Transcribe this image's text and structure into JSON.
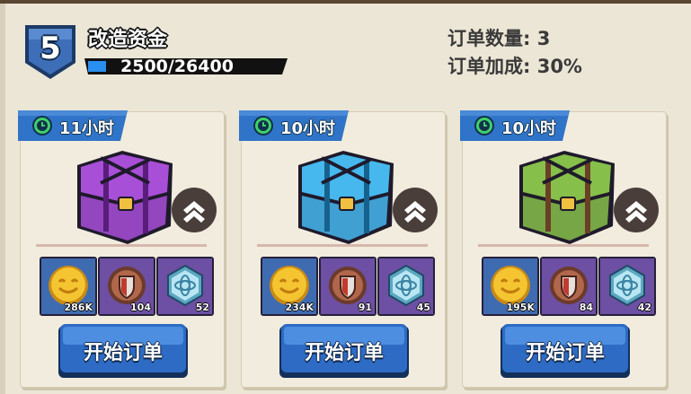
{
  "header": {
    "level": "5",
    "title": "改造资金",
    "progress_text": "2500/26400",
    "progress_value": 2500,
    "progress_max": 26400,
    "order_count": "订单数量: 3",
    "order_bonus": "订单加成: 30%"
  },
  "cards": [
    {
      "timer": "11小时",
      "chest_color": "#a84fd8",
      "chest_trim": "#5a1d7c",
      "rewards": [
        {
          "icon": "gold-coin-icon",
          "count": "286K"
        },
        {
          "icon": "bronze-shield-medal-icon",
          "count": "104"
        },
        {
          "icon": "blue-hexagon-gem-icon",
          "count": "52"
        }
      ],
      "button": "开始订单"
    },
    {
      "timer": "10小时",
      "chest_color": "#46b8ee",
      "chest_trim": "#16628f",
      "rewards": [
        {
          "icon": "gold-coin-icon",
          "count": "234K"
        },
        {
          "icon": "bronze-shield-medal-icon",
          "count": "91"
        },
        {
          "icon": "blue-hexagon-gem-icon",
          "count": "45"
        }
      ],
      "button": "开始订单"
    },
    {
      "timer": "10小时",
      "chest_color": "#86c04a",
      "chest_trim": "#6b3f26",
      "rewards": [
        {
          "icon": "gold-coin-icon",
          "count": "195K"
        },
        {
          "icon": "bronze-shield-medal-icon",
          "count": "84"
        },
        {
          "icon": "blue-hexagon-gem-icon",
          "count": "42"
        }
      ],
      "button": "开始订单"
    }
  ],
  "colors": {
    "background": "#ece6d6",
    "badge_blue": "#3e6eb8",
    "button_blue": "#2d6bc4",
    "timer_tab_blue": "#2f74c8",
    "clock_green": "#3fd06a",
    "reward_bg_purple": "#6d4fa3"
  }
}
